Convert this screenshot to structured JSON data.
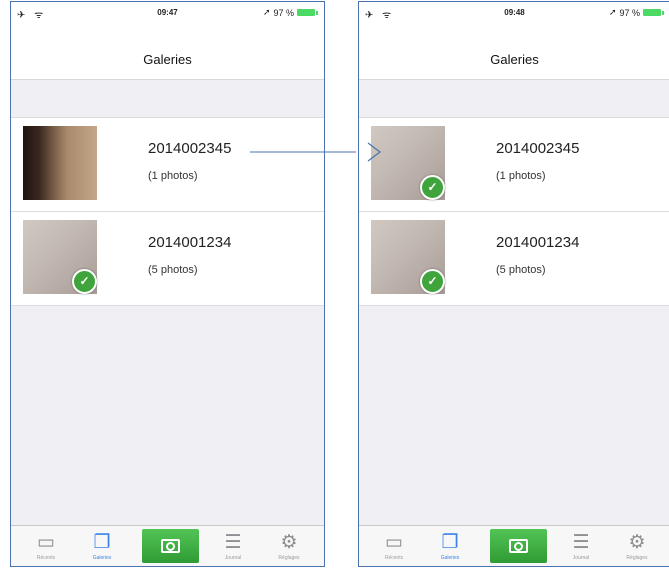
{
  "screens": [
    {
      "status": {
        "time": "09:47",
        "signal": "✈ ᯤ",
        "battery_text": "97 %"
      },
      "title": "Galeries",
      "galleries": [
        {
          "name": "2014002345",
          "count": "(1 photos)",
          "checked": false,
          "thumb": "dark"
        },
        {
          "name": "2014001234",
          "count": "(5 photos)",
          "checked": true,
          "thumb": "light"
        }
      ],
      "tabs": [
        {
          "label": "Récents",
          "icon": "tray-icon",
          "glyph": "▭"
        },
        {
          "label": "Galeries",
          "icon": "galleries-icon",
          "glyph": "❐"
        },
        {
          "label": "",
          "icon": "camera-icon",
          "glyph": ""
        },
        {
          "label": "Journal",
          "icon": "list-icon",
          "glyph": "☰"
        },
        {
          "label": "Réglages",
          "icon": "settings-icon",
          "glyph": "⚙"
        }
      ]
    },
    {
      "status": {
        "time": "09:48",
        "signal": "✈ ᯤ",
        "battery_text": "97 %"
      },
      "title": "Galeries",
      "galleries": [
        {
          "name": "2014002345",
          "count": "(1 photos)",
          "checked": true,
          "thumb": "light"
        },
        {
          "name": "2014001234",
          "count": "(5 photos)",
          "checked": true,
          "thumb": "light"
        }
      ],
      "tabs": [
        {
          "label": "Récents",
          "icon": "tray-icon",
          "glyph": "▭"
        },
        {
          "label": "Galeries",
          "icon": "galleries-icon",
          "glyph": "❐"
        },
        {
          "label": "",
          "icon": "camera-icon",
          "glyph": ""
        },
        {
          "label": "Journal",
          "icon": "list-icon",
          "glyph": "☰"
        },
        {
          "label": "Réglages",
          "icon": "settings-icon",
          "glyph": "⚙"
        }
      ]
    }
  ],
  "colors": {
    "accent": "#3c82e6",
    "check": "#3fa43c",
    "camera": "#3fae44",
    "frame": "#4a72ac"
  }
}
